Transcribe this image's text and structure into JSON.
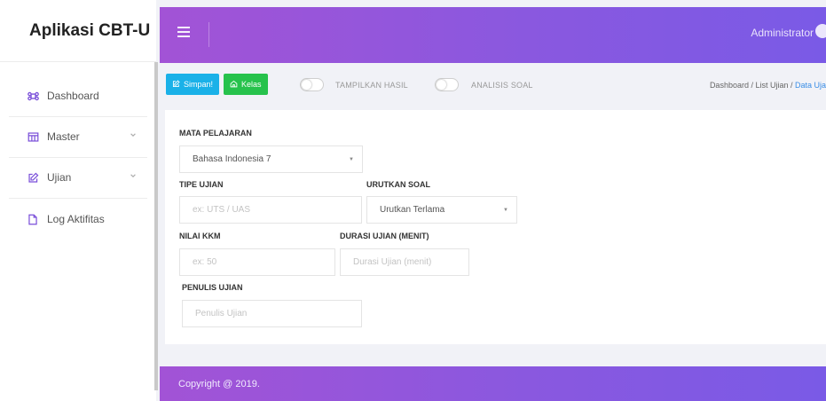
{
  "app": {
    "title": "Aplikasi CBT-U"
  },
  "sidebar": {
    "items": [
      {
        "label": "Dashboard",
        "icon": "command-icon",
        "has_submenu": false
      },
      {
        "label": "Master",
        "icon": "table-icon",
        "has_submenu": true
      },
      {
        "label": "Ujian",
        "icon": "edit-icon",
        "has_submenu": true
      },
      {
        "label": "Log Aktifitas",
        "icon": "file-icon",
        "has_submenu": false
      }
    ]
  },
  "header": {
    "user": "Administrator",
    "menu_icon": "hamburger-icon"
  },
  "toolbar": {
    "save_label": "Simpan!",
    "kelas_label": "Kelas",
    "toggle_hasil_label": "TAMPILKAN HASIL",
    "toggle_analisis_label": "ANALISIS SOAL",
    "toggle_hasil_on": false,
    "toggle_analisis_on": false
  },
  "breadcrumb": {
    "items": [
      "Dashboard",
      "List Ujian"
    ],
    "active": "Data Ujian",
    "text_prefix": "Dashboard / List Ujian / ",
    "active_visible": "Data Uja"
  },
  "form": {
    "mata_pelajaran": {
      "label": "MATA PELAJARAN",
      "value": "Bahasa Indonesia 7"
    },
    "tipe_ujian": {
      "label": "TIPE UJIAN",
      "placeholder": "ex: UTS / UAS"
    },
    "urutkan_soal": {
      "label": "URUTKAN SOAL",
      "value": "Urutkan Terlama"
    },
    "nilai_kkm": {
      "label": "NILAI KKM",
      "placeholder": "ex: 50"
    },
    "durasi_ujian": {
      "label": "DURASI UJIAN (MENIT)",
      "placeholder": "Durasi Ujian (menit)"
    },
    "penulis_ujian": {
      "label": "PENULIS UJIAN",
      "placeholder": "Penulis Ujian"
    }
  },
  "footer": {
    "text": "Copyright @ 2019."
  },
  "colors": {
    "header_gradient_start": "#a253d6",
    "header_gradient_end": "#7a5ae6",
    "save_button": "#1ab1e8",
    "kelas_button": "#27c24c",
    "breadcrumb_active": "#3a8ee6"
  }
}
